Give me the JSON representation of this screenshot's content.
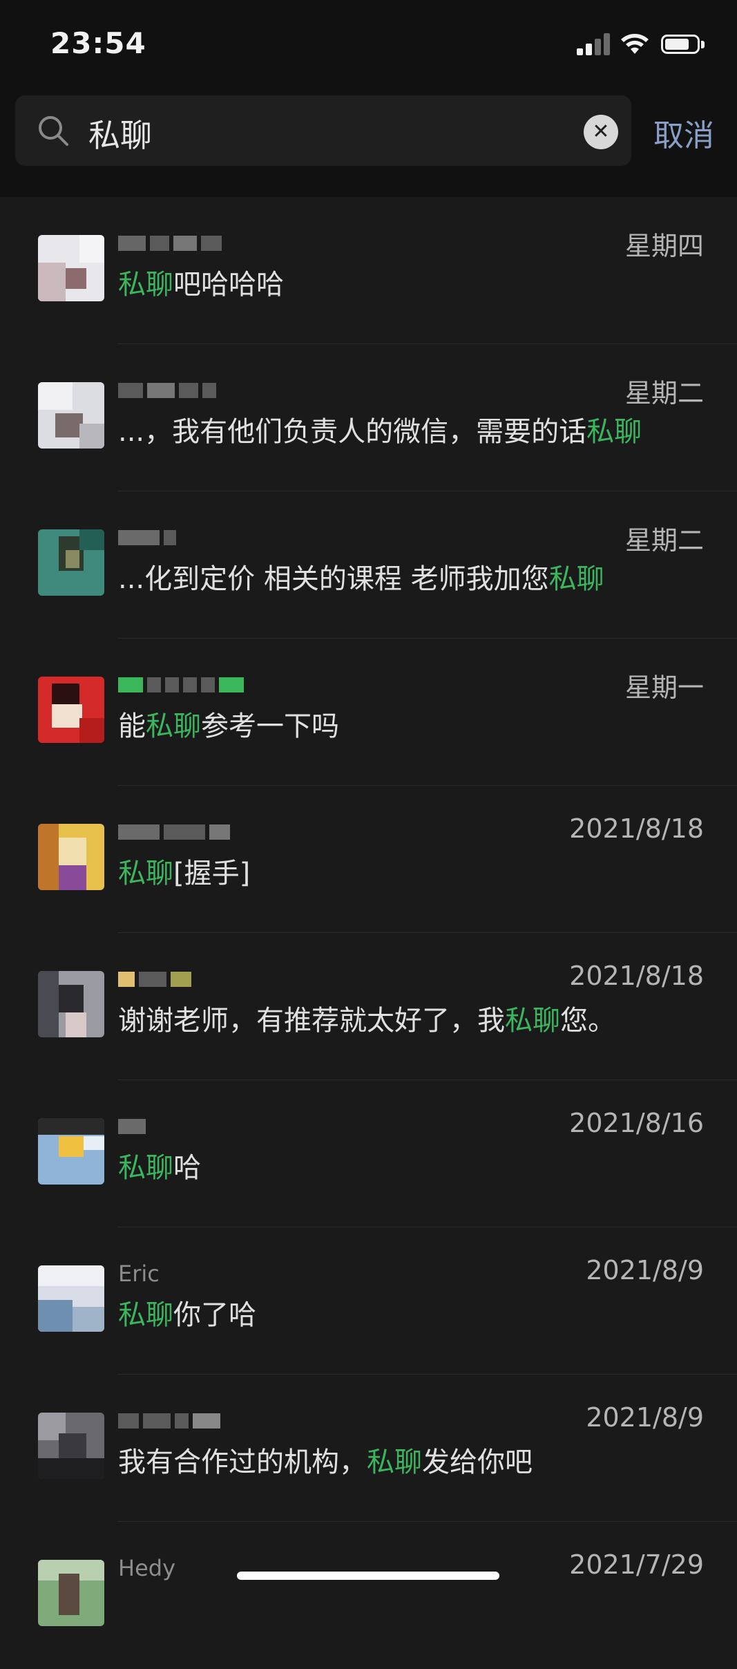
{
  "status_bar": {
    "time": "23:54",
    "signal_bars": 2,
    "signal_total": 4,
    "battery_level": 0.7
  },
  "search": {
    "query": "私聊",
    "cancel_label": "取消"
  },
  "icons": {
    "search": "search-icon",
    "clear": "clear-icon",
    "wifi": "wifi-icon",
    "battery": "battery-icon",
    "signal": "signal-icon"
  },
  "colors": {
    "highlight": "#3cb55f",
    "cancel": "#8a9fc8",
    "background": "#1a1a1a"
  },
  "results": [
    {
      "name": "",
      "date": "星期四",
      "pre": "",
      "hl": "私聊",
      "post": "吧哈哈哈"
    },
    {
      "name": "",
      "date": "星期二",
      "pre": "...，我有他们负责人的微信，需要的话",
      "hl": "私聊",
      "post": ""
    },
    {
      "name": "",
      "date": "星期二",
      "pre": "...化到定价 相关的课程 老师我加您",
      "hl": "私聊",
      "post": ""
    },
    {
      "name": "",
      "date": "星期一",
      "pre": "能",
      "hl": "私聊",
      "post": "参考一下吗"
    },
    {
      "name": "",
      "date": "2021/8/18",
      "pre": "",
      "hl": "私聊",
      "post": "[握手]"
    },
    {
      "name": "",
      "date": "2021/8/18",
      "pre": "谢谢老师，有推荐就太好了，我",
      "hl": "私聊",
      "post": "您。"
    },
    {
      "name": "",
      "date": "2021/8/16",
      "pre": "",
      "hl": "私聊",
      "post": "哈"
    },
    {
      "name": "Eric",
      "date": "2021/8/9",
      "pre": "",
      "hl": "私聊",
      "post": "你了哈"
    },
    {
      "name": "",
      "date": "2021/8/9",
      "pre": "我有合作过的机构，",
      "hl": "私聊",
      "post": "发给你吧"
    },
    {
      "name": "Hedy",
      "date": "2021/7/29",
      "pre": "",
      "hl": "",
      "post": ""
    }
  ]
}
